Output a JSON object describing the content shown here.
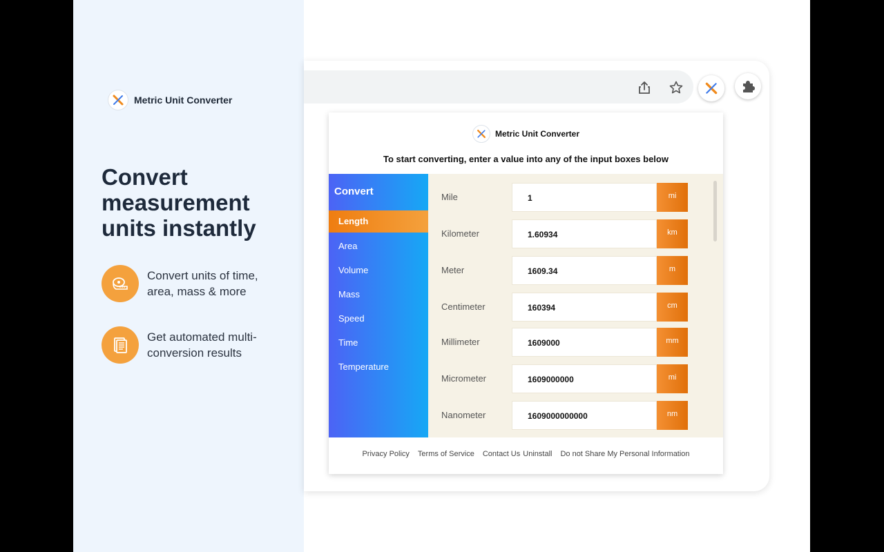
{
  "app": {
    "name": "Metric Unit Converter"
  },
  "promo": {
    "headline": "Convert measurement units instantly",
    "features": [
      {
        "icon": "measuring-tape-icon",
        "text": "Convert units of time, area, mass & more"
      },
      {
        "icon": "document-list-icon",
        "text": "Get automated multi-conversion results"
      }
    ]
  },
  "browser": {
    "toolbar_icons": [
      "share-icon",
      "star-icon",
      "extension-logo-icon",
      "puzzle-icon"
    ]
  },
  "popup": {
    "brand": "Metric Unit Converter",
    "instruction": "To start converting, enter a value into any of the input boxes below",
    "sidebar": {
      "title": "Convert",
      "items": [
        {
          "label": "Length",
          "active": true
        },
        {
          "label": "Area",
          "active": false
        },
        {
          "label": "Volume",
          "active": false
        },
        {
          "label": "Mass",
          "active": false
        },
        {
          "label": "Speed",
          "active": false
        },
        {
          "label": "Time",
          "active": false
        },
        {
          "label": "Temperature",
          "active": false
        }
      ]
    },
    "rows": [
      {
        "label": "Mile",
        "value": "1",
        "unit": "mi"
      },
      {
        "label": "Kilometer",
        "value": "1.60934",
        "unit": "km"
      },
      {
        "label": "Meter",
        "value": "1609.34",
        "unit": "m"
      },
      {
        "label": "Centimeter",
        "value": "160394",
        "unit": "cm"
      },
      {
        "label": "Millimeter",
        "value": "1609000",
        "unit": "mm"
      },
      {
        "label": "Micrometer",
        "value": "1609000000",
        "unit": "mi"
      },
      {
        "label": "Nanometer",
        "value": "1609000000000",
        "unit": "nm"
      }
    ],
    "footer": [
      "Privacy Policy",
      "Terms of Service",
      "Contact Us",
      "Uninstall",
      "Do not Share My Personal Information"
    ]
  },
  "colors": {
    "accent_orange": "#f4a13d",
    "sidebar_start": "#4c63f5",
    "sidebar_end": "#16a8f5",
    "content_bg": "#f6f2e6"
  }
}
